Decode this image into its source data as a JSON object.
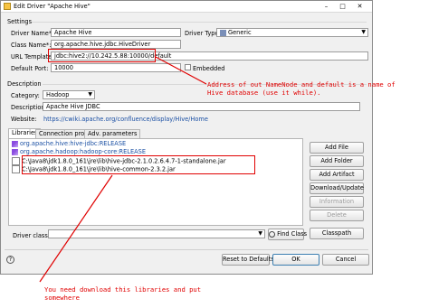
{
  "window": {
    "title": "Edit Driver \"Apache Hive\"",
    "minimize": "–",
    "maximize": "□",
    "close": "✕"
  },
  "settings": {
    "heading": "Settings",
    "driver_name_label": "Driver Name*:",
    "driver_name_value": "Apache Hive",
    "driver_type_label": "Driver Type:",
    "driver_type_value": "Generic",
    "class_name_label": "Class Name*:",
    "class_name_value": "org.apache.hive.jdbc.HiveDriver",
    "url_template_label": "URL Template:",
    "url_template_value": "jdbc:hive2://10.242.5.88:10000/default",
    "default_port_label": "Default Port:",
    "default_port_value": "10000",
    "embedded_label": "Embedded"
  },
  "description": {
    "heading": "Description",
    "category_label": "Category:",
    "category_value": "Hadoop",
    "description_label": "Description:",
    "description_value": "Apache Hive JDBC",
    "website_label": "Website:",
    "website_value": "https://cwiki.apache.org/confluence/display/Hive/Home"
  },
  "tabs": [
    "Libraries",
    "Connection properties",
    "Adv. parameters"
  ],
  "libraries": [
    {
      "type": "jar",
      "text": "org.apache.hive:hive-jdbc:RELEASE"
    },
    {
      "type": "jar",
      "text": "org.apache.hadoop:hadoop-core:RELEASE"
    },
    {
      "type": "file",
      "text": "C:\\Java8\\jdk1.8.0_161\\jre\\lib\\hive-jdbc-2.1.0.2.6.4.7-1-standalone.jar"
    },
    {
      "type": "file",
      "text": "C:\\Java8\\jdk1.8.0_161\\jre\\lib\\hive-common-2.3.2.jar"
    }
  ],
  "side_buttons": {
    "add_file": "Add File",
    "add_folder": "Add Folder",
    "add_artifact": "Add Artifact",
    "download_update": "Download/Update",
    "information": "Information",
    "delete": "Delete",
    "classpath": "Classpath"
  },
  "driver_class": {
    "label": "Driver class:",
    "find_class": "Find Class"
  },
  "footer": {
    "reset": "Reset to Defaults",
    "ok": "OK",
    "cancel": "Cancel"
  },
  "annotations": {
    "url_note_line1": "Address of out NameNode and default is a name of",
    "url_note_line2": "Hive database (use it while).",
    "lib_note_line1": "You need download this libraries and put",
    "lib_note_line2": "somewhere"
  },
  "colors": {
    "annotation": "#e00000",
    "link": "#1a4fa3"
  }
}
